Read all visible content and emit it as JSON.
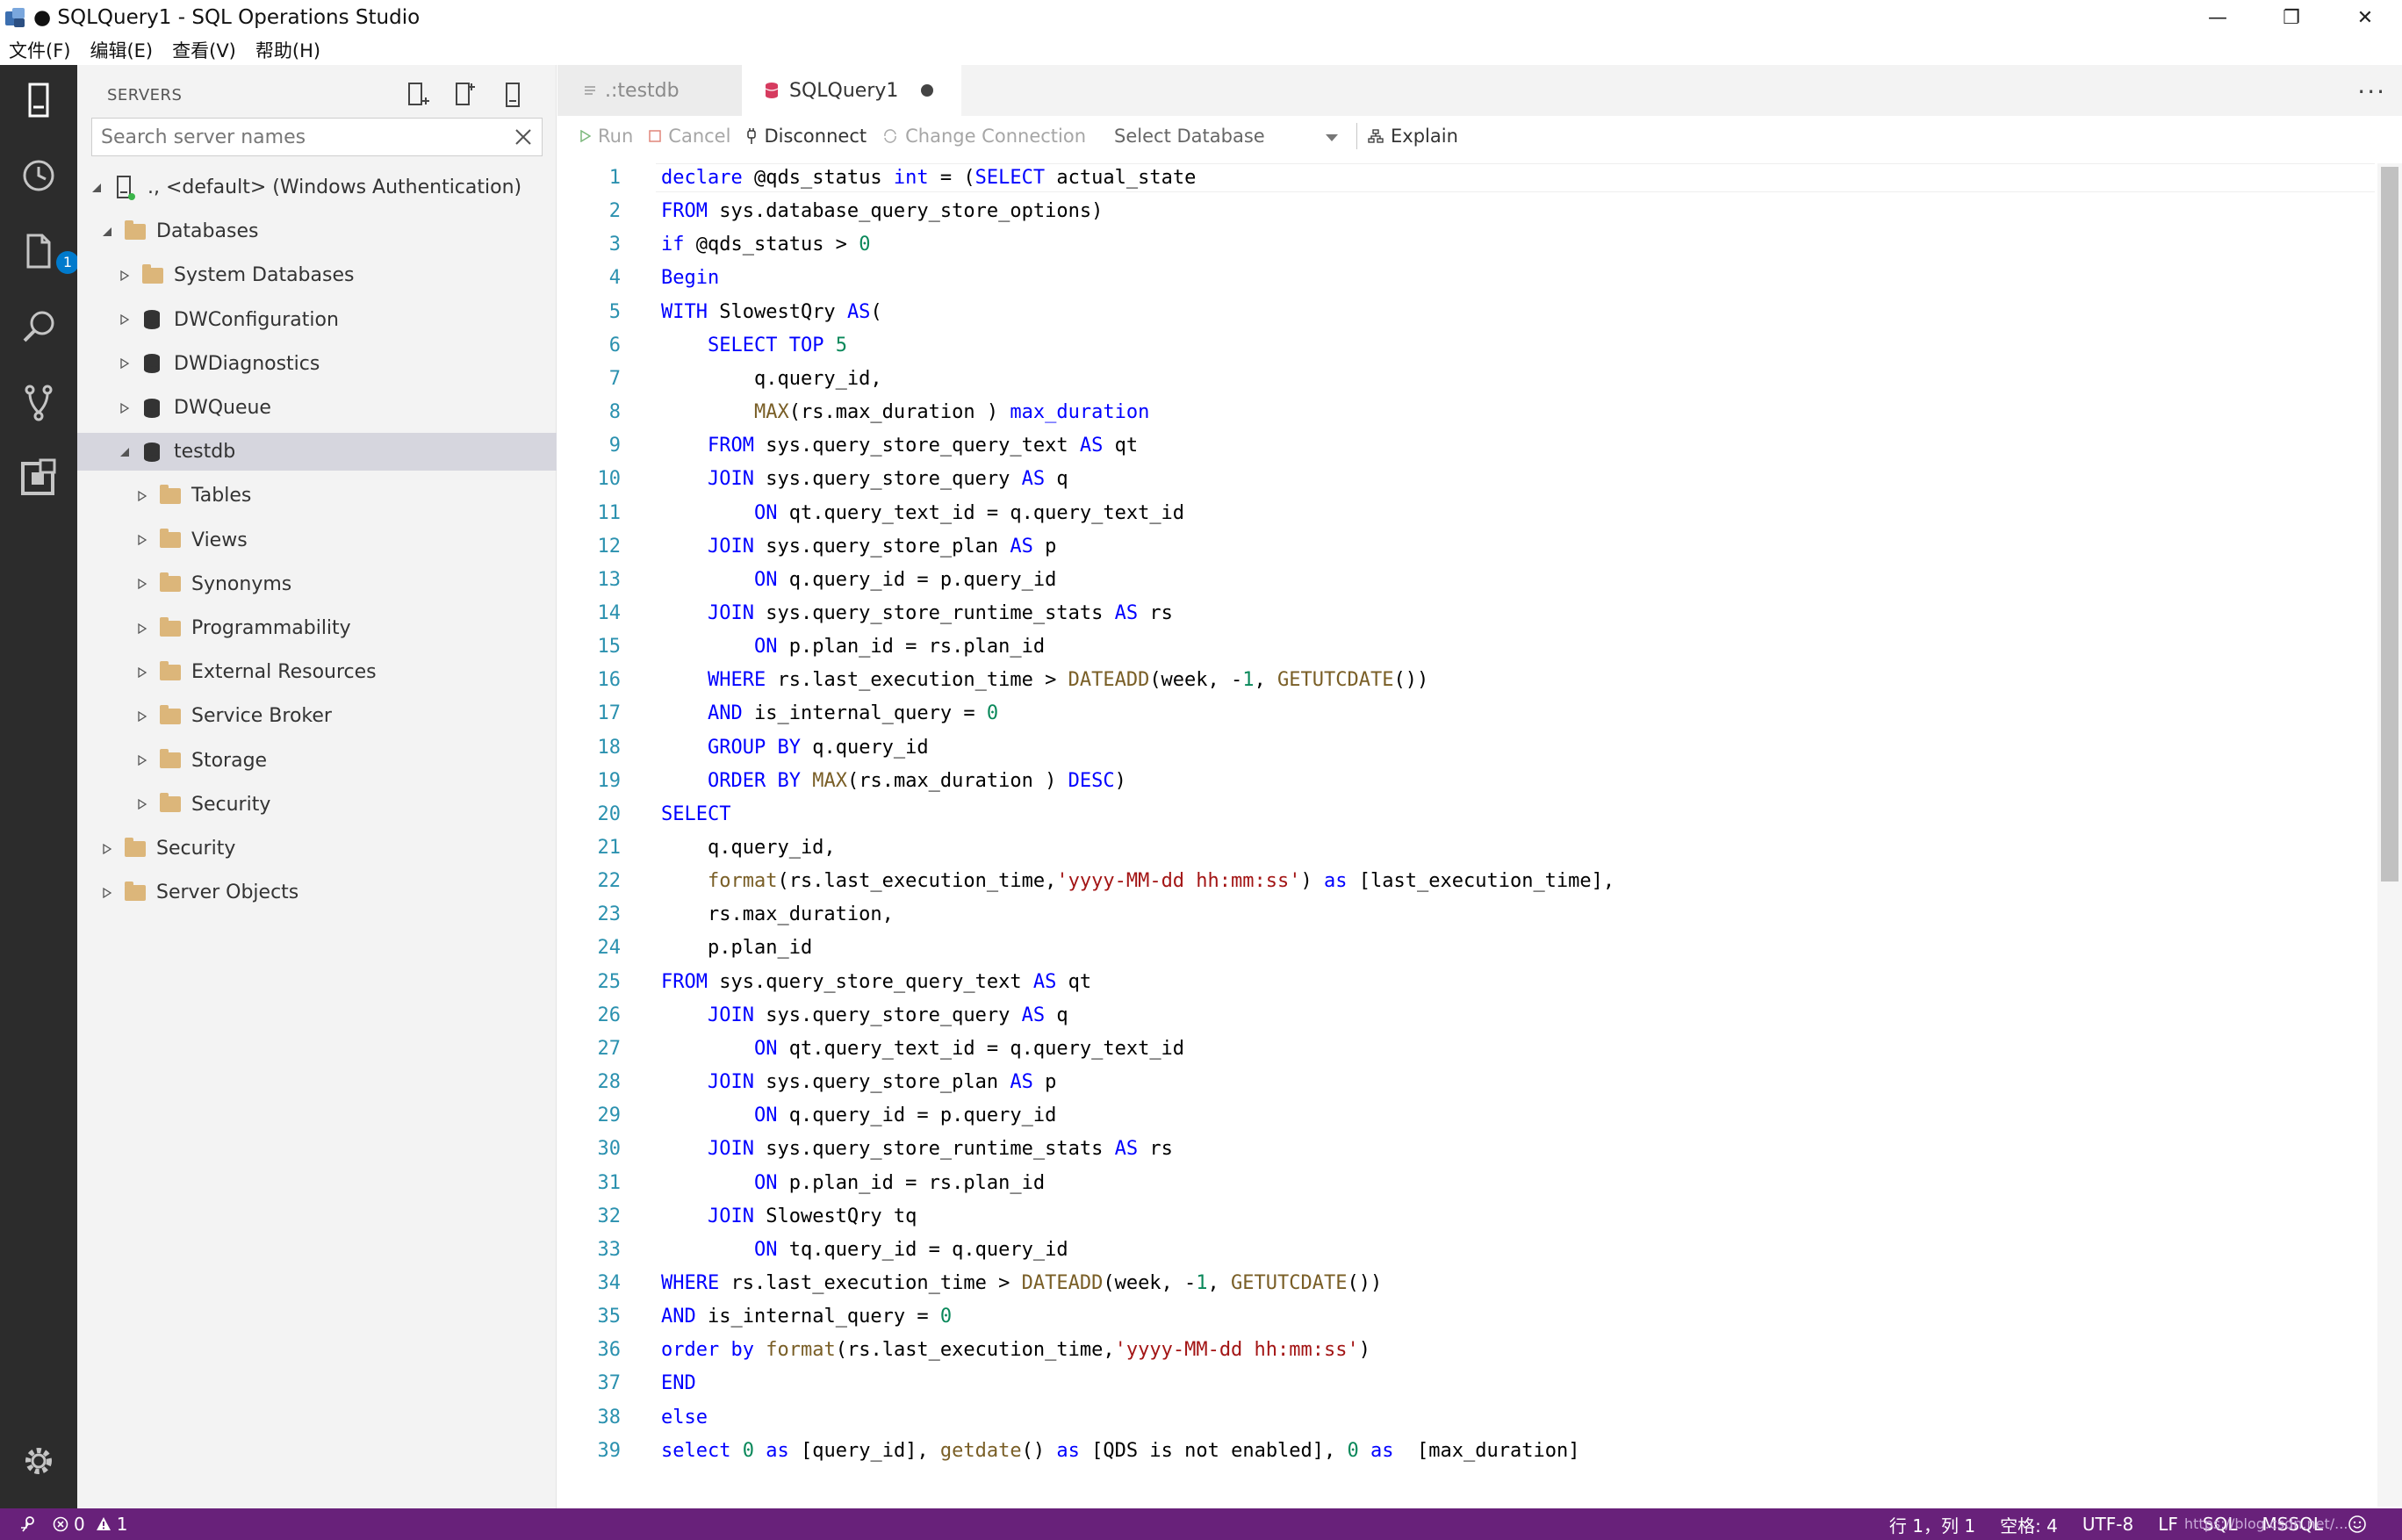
{
  "window": {
    "title": "● SQLQuery1 - SQL Operations Studio",
    "minimize": "—",
    "restore": "❐",
    "close": "✕"
  },
  "menu": [
    "文件(F)",
    "编辑(E)",
    "查看(V)",
    "帮助(H)"
  ],
  "activity": {
    "explorer_badge": "1"
  },
  "sidebar": {
    "header": "SERVERS",
    "search_placeholder": "Search server names",
    "server": "., <default> (Windows Authentication)",
    "items": [
      {
        "label": "Databases",
        "level": 1,
        "kind": "folder",
        "expanded": true
      },
      {
        "label": "System Databases",
        "level": 2,
        "kind": "folder"
      },
      {
        "label": "DWConfiguration",
        "level": 2,
        "kind": "db"
      },
      {
        "label": "DWDiagnostics",
        "level": 2,
        "kind": "db"
      },
      {
        "label": "DWQueue",
        "level": 2,
        "kind": "db"
      },
      {
        "label": "testdb",
        "level": 2,
        "kind": "db",
        "expanded": true,
        "selected": true
      },
      {
        "label": "Tables",
        "level": 3,
        "kind": "folder"
      },
      {
        "label": "Views",
        "level": 3,
        "kind": "folder"
      },
      {
        "label": "Synonyms",
        "level": 3,
        "kind": "folder"
      },
      {
        "label": "Programmability",
        "level": 3,
        "kind": "folder"
      },
      {
        "label": "External Resources",
        "level": 3,
        "kind": "folder"
      },
      {
        "label": "Service Broker",
        "level": 3,
        "kind": "folder"
      },
      {
        "label": "Storage",
        "level": 3,
        "kind": "folder"
      },
      {
        "label": "Security",
        "level": 3,
        "kind": "folder"
      },
      {
        "label": "Security",
        "level": 1,
        "kind": "folder"
      },
      {
        "label": "Server Objects",
        "level": 1,
        "kind": "folder"
      }
    ]
  },
  "tabs": {
    "inactive": ".:testdb",
    "active": "SQLQuery1"
  },
  "toolbar": {
    "run": "Run",
    "cancel": "Cancel",
    "disconnect": "Disconnect",
    "change_connection": "Change Connection",
    "select_database": "Select Database",
    "explain": "Explain"
  },
  "code_lines": [
    "declare @qds_status int = (SELECT actual_state",
    "FROM sys.database_query_store_options)",
    "if @qds_status > 0",
    "Begin",
    "WITH SlowestQry AS(",
    "    SELECT TOP 5",
    "        q.query_id,",
    "        MAX(rs.max_duration ) max_duration",
    "    FROM sys.query_store_query_text AS qt",
    "    JOIN sys.query_store_query AS q",
    "        ON qt.query_text_id = q.query_text_id",
    "    JOIN sys.query_store_plan AS p",
    "        ON q.query_id = p.query_id",
    "    JOIN sys.query_store_runtime_stats AS rs",
    "        ON p.plan_id = rs.plan_id",
    "    WHERE rs.last_execution_time > DATEADD(week, -1, GETUTCDATE())",
    "    AND is_internal_query = 0",
    "    GROUP BY q.query_id",
    "    ORDER BY MAX(rs.max_duration ) DESC)",
    "SELECT",
    "    q.query_id,",
    "    format(rs.last_execution_time,'yyyy-MM-dd hh:mm:ss') as [last_execution_time],",
    "    rs.max_duration,",
    "    p.plan_id",
    "FROM sys.query_store_query_text AS qt",
    "    JOIN sys.query_store_query AS q",
    "        ON qt.query_text_id = q.query_text_id",
    "    JOIN sys.query_store_plan AS p",
    "        ON q.query_id = p.query_id",
    "    JOIN sys.query_store_runtime_stats AS rs",
    "        ON p.plan_id = rs.plan_id",
    "    JOIN SlowestQry tq",
    "        ON tq.query_id = q.query_id",
    "WHERE rs.last_execution_time > DATEADD(week, -1, GETUTCDATE())",
    "AND is_internal_query = 0",
    "order by format(rs.last_execution_time,'yyyy-MM-dd hh:mm:ss')",
    "END",
    "else",
    "select 0 as [query_id], getdate() as [QDS is not enabled], 0 as  [max_duration]"
  ],
  "status": {
    "errors": "0",
    "warnings": "1",
    "position": "行 1，列 1",
    "spaces": "空格: 4",
    "encoding": "UTF-8",
    "eol": "LF",
    "language": "SQL",
    "provider": "MSSQL",
    "watermark": "https://blog.csdn.net/..."
  },
  "colors": {
    "status_bar": "#68217a",
    "activity_bar": "#2c2c2c",
    "sidebar": "#f3f3f3",
    "keyword": "#0000ff",
    "function": "#795e26",
    "number": "#09885a",
    "string": "#a31515",
    "line_number": "#2b91af"
  }
}
